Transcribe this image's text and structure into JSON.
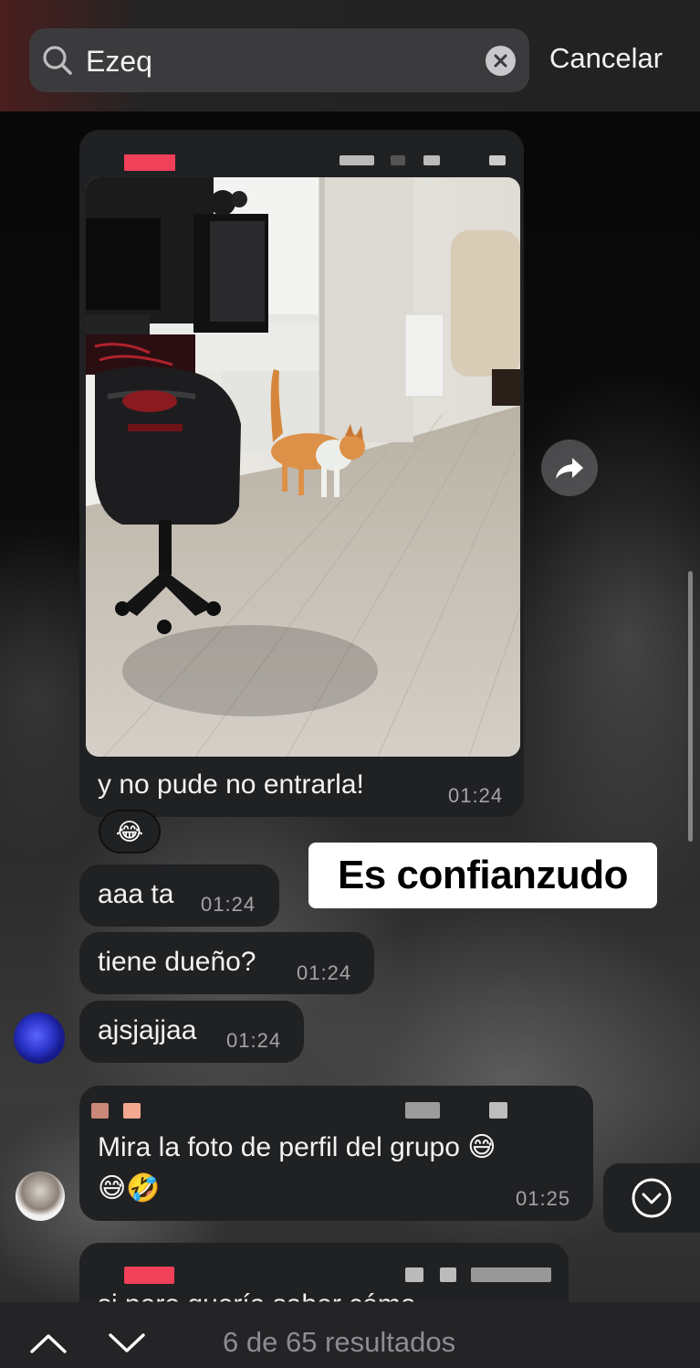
{
  "search": {
    "query": "Ezeq",
    "cancel_label": "Cancelar"
  },
  "messages": [
    {
      "text": "y no pude no entrarla!",
      "time": "01:24",
      "has_photo": true,
      "reaction": "😂"
    },
    {
      "text": "aaa ta",
      "time": "01:24"
    },
    {
      "text": "tiene dueño?",
      "time": "01:24"
    },
    {
      "text": "ajsjajjaa",
      "time": "01:24"
    },
    {
      "text_line1": "Mira la foto de perfil del grupo 😅",
      "text_line2": "😅🤣",
      "time": "01:25"
    },
    {
      "partial_text": "si pero quería saber cómo"
    }
  ],
  "overlay_caption": "Es confianzudo",
  "footer": {
    "results_text": "6 de 65 resultados"
  },
  "icons": {
    "search": "search-icon",
    "clear": "clear-icon",
    "forward": "forward-icon",
    "scroll_down": "chevron-down-circle-icon",
    "prev": "chevron-up-icon",
    "next": "chevron-down-icon"
  },
  "colors": {
    "bubble": "#202123",
    "header": "#222222",
    "search_box": "#3b3b3d",
    "time": "#a4a4a6",
    "results": "#8d8d91",
    "redacted_red": "#f0405a"
  }
}
